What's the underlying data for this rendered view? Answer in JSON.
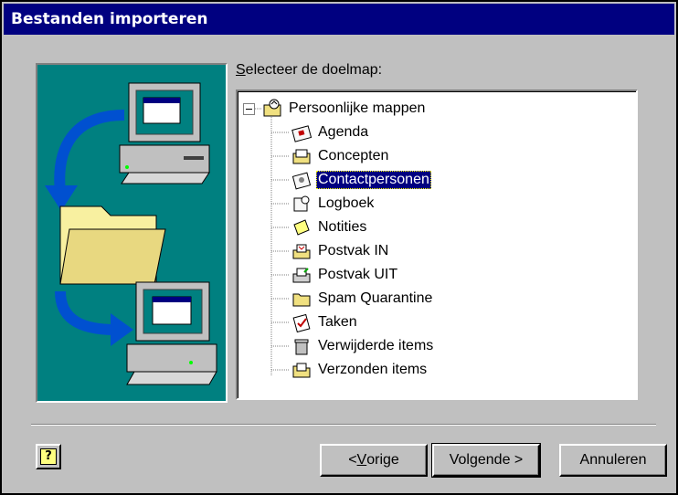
{
  "window": {
    "title": "Bestanden importeren"
  },
  "folder_picker": {
    "label": "Selecteer de doelmap:",
    "root": {
      "label": "Persoonlijke mappen",
      "icon": "personal-folders-icon",
      "expanded": true
    },
    "items": [
      {
        "label": "Agenda",
        "icon": "calendar-icon"
      },
      {
        "label": "Concepten",
        "icon": "drafts-icon"
      },
      {
        "label": "Contactpersonen",
        "icon": "contacts-icon",
        "selected": true
      },
      {
        "label": "Logboek",
        "icon": "journal-icon"
      },
      {
        "label": "Notities",
        "icon": "notes-icon"
      },
      {
        "label": "Postvak IN",
        "icon": "inbox-icon"
      },
      {
        "label": "Postvak UIT",
        "icon": "outbox-icon"
      },
      {
        "label": "Spam Quarantine",
        "icon": "folder-icon"
      },
      {
        "label": "Taken",
        "icon": "tasks-icon"
      },
      {
        "label": "Verwijderde items",
        "icon": "trash-icon"
      },
      {
        "label": "Verzonden items",
        "icon": "sent-items-icon"
      }
    ]
  },
  "buttons": {
    "back": {
      "prefix": "< ",
      "mnemonic": "V",
      "rest": "orige"
    },
    "next": {
      "label": "Volgende >"
    },
    "cancel": {
      "label": "Annuleren"
    },
    "help": {
      "label": "?"
    }
  },
  "colors": {
    "titlebar": "#000080",
    "dialog_bg": "#c0c0c0",
    "illustration_bg": "#008080",
    "selection": "#000080"
  }
}
